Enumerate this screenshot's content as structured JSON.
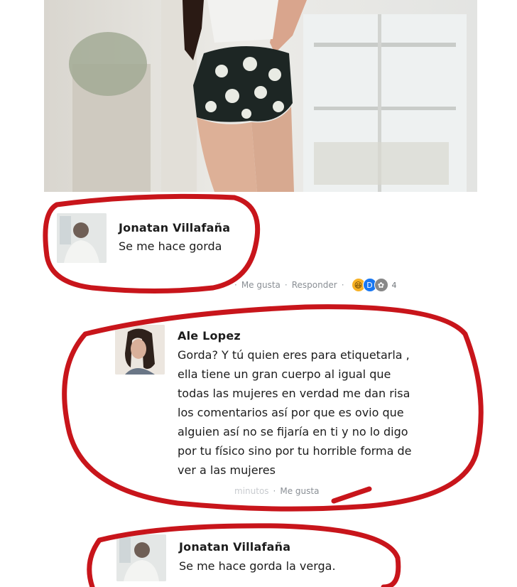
{
  "post_image": {
    "description_icon": "photo-woman-floral-shorts"
  },
  "comments": [
    {
      "author": "Jonatan Villafaña",
      "lines": [
        "Se me hace gorda"
      ],
      "actions": {
        "like": "Me gusta",
        "reply": "Responder",
        "reaction_icons": [
          "haha-icon",
          "wow-icon",
          "care-icon"
        ],
        "reaction_count": "4"
      }
    },
    {
      "author": "Ale Lopez",
      "lines": [
        "Gorda? Y tú quien eres para etiquetarla ,",
        "ella tiene un gran cuerpo al igual que",
        "todas las mujeres en verdad me dan risa",
        "los comentarios así por que es ovio que",
        "alguien así no se fijaría en ti y no lo digo",
        "por tu físico sino por tu horrible forma de",
        "ver a las mujeres"
      ],
      "actions": {
        "time": "minutos",
        "like": "Me gusta"
      }
    },
    {
      "author": "Jonatan Villafaña",
      "lines": [
        "Se me hace gorda la verga."
      ]
    }
  ],
  "colors": {
    "annotation_red": "#c8151b",
    "reaction_haha": "#f7b125",
    "reaction_wow": "#1877f2"
  }
}
